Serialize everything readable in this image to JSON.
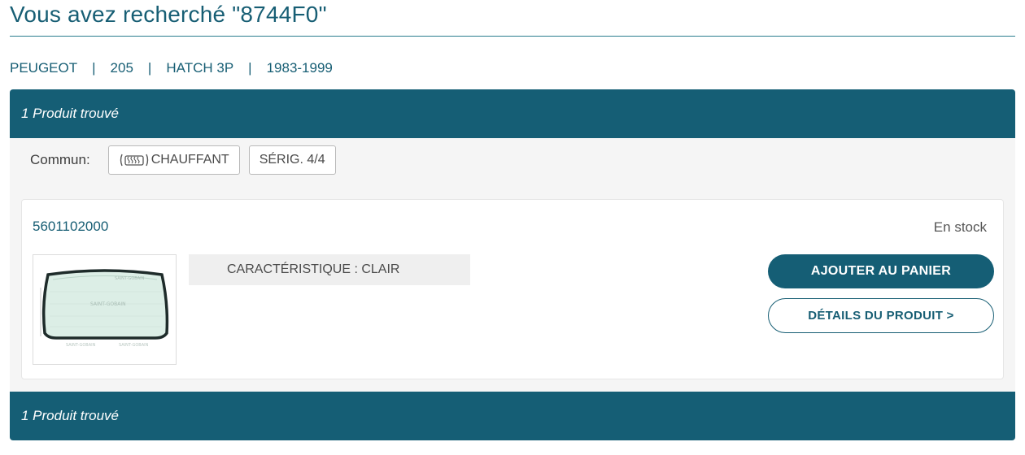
{
  "search": {
    "title": "Vous avez recherché \"8744F0\""
  },
  "breadcrumb": {
    "items": [
      "PEUGEOT",
      "205",
      "HATCH 3P",
      "1983-1999"
    ],
    "separator": "|"
  },
  "results": {
    "count_label": "1 Produit trouvé",
    "common_label": "Commun:",
    "tags": [
      {
        "label": "CHAUFFANT",
        "icon": "heated-window-icon"
      },
      {
        "label": "SÉRIG. 4/4"
      }
    ]
  },
  "product": {
    "reference": "5601102000",
    "stock_status": "En stock",
    "feature": "CARACTÉRISTIQUE : CLAIR",
    "image_icon": "rear-windshield-image",
    "add_to_cart_label": "AJOUTER AU PANIER",
    "details_label": "DÉTAILS DU PRODUIT >"
  },
  "colors": {
    "brand": "#155e75",
    "panel_bg": "#f5f5f5"
  }
}
